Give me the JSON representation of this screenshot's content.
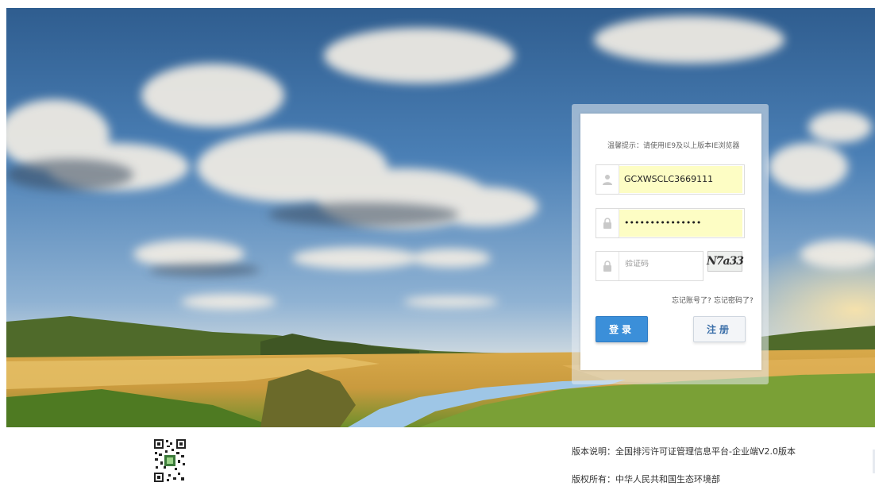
{
  "login": {
    "tip": "温馨提示：请使用IE9及以上版本IE浏览器",
    "username_value": "GCXWSCLC3669111",
    "password_value": "•••••••••••••••",
    "captcha_placeholder": "验证码",
    "captcha_text": "N7a33",
    "forgot_account": "忘记账号了?",
    "forgot_password": "忘记密码了?",
    "login_button": "登录",
    "register_button": "注册"
  },
  "footer": {
    "version": "版本说明：全国排污许可证管理信息平台-企业端V2.0版本",
    "copyright": "版权所有：中华人民共和国生态环境部"
  },
  "icons": {
    "user": "user-icon",
    "lock": "lock-icon",
    "qr": "qr-code-icon"
  },
  "colors": {
    "primary_button": "#3b8fd9",
    "autofill_background": "#fdfdc4"
  }
}
